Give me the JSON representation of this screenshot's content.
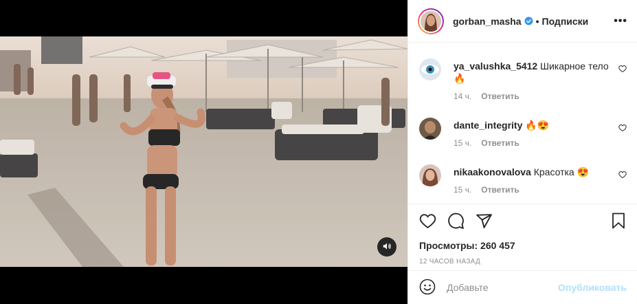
{
  "post": {
    "author": "gorban_masha",
    "separator": "•",
    "follow_label": "Подписки",
    "more_label": "•••"
  },
  "comments": [
    {
      "username": "ya_valushka_5412",
      "text": "Шикарное тело 🔥",
      "time": "14 ч.",
      "reply_label": "Ответить"
    },
    {
      "username": "dante_integrity",
      "text": "🔥😍",
      "time": "15 ч.",
      "reply_label": "Ответить"
    },
    {
      "username": "nikaakonovalova",
      "text": "Красотка 😍",
      "time": "15 ч.",
      "reply_label": "Ответить"
    }
  ],
  "stats": {
    "views": "Просмотры: 260 457",
    "time_ago": "12 ЧАСОВ НАЗАД"
  },
  "add_comment": {
    "placeholder": "Добавьте",
    "publish_label": "Опубликовать"
  },
  "colors": {
    "verified": "#3897f0",
    "publish_disabled": "#b2dffc",
    "muted_text": "#8e8e8e",
    "border": "#efefef"
  },
  "icons": [
    "volume-icon",
    "verified-icon",
    "heart-icon",
    "comment-icon",
    "share-icon",
    "bookmark-icon",
    "emoji-icon"
  ]
}
